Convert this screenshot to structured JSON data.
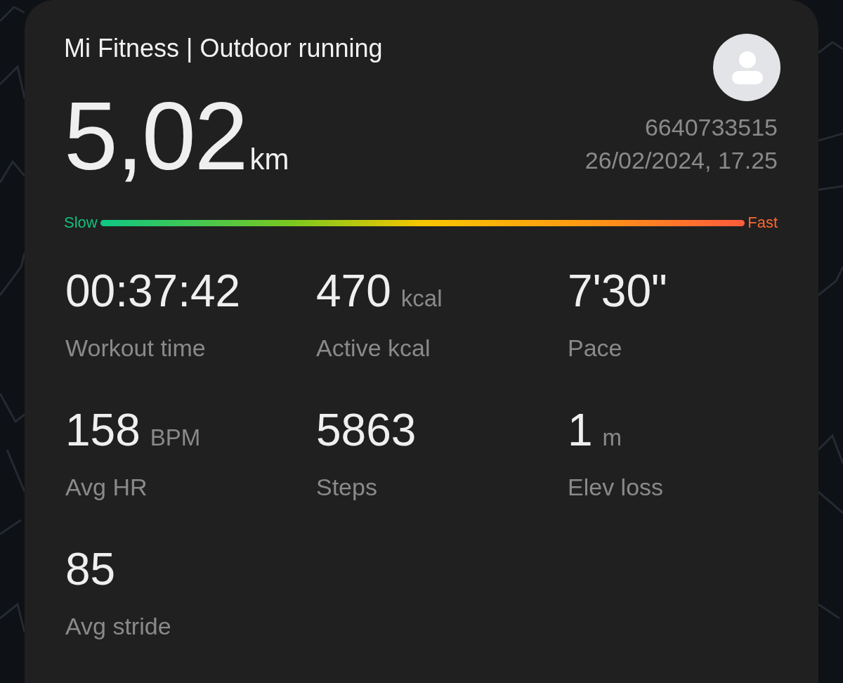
{
  "header": {
    "title": "Mi Fitness | Outdoor running",
    "distance": "5,02",
    "distance_unit": "km",
    "user_id": "6640733515",
    "datetime": "26/02/2024, 17.25"
  },
  "pace_scale": {
    "low_label": "Slow",
    "high_label": "Fast"
  },
  "stats": [
    {
      "value": "00:37:42",
      "label": "Workout time"
    },
    {
      "value": "470",
      "unit": "kcal",
      "label": "Active kcal"
    },
    {
      "value": "7'30\"",
      "label": "Pace"
    },
    {
      "value": "158",
      "unit": "BPM",
      "label": "Avg HR"
    },
    {
      "value": "5863",
      "label": "Steps"
    },
    {
      "value": "1",
      "unit": "m",
      "label": "Elev loss"
    },
    {
      "value": "85",
      "label": "Avg stride"
    }
  ]
}
